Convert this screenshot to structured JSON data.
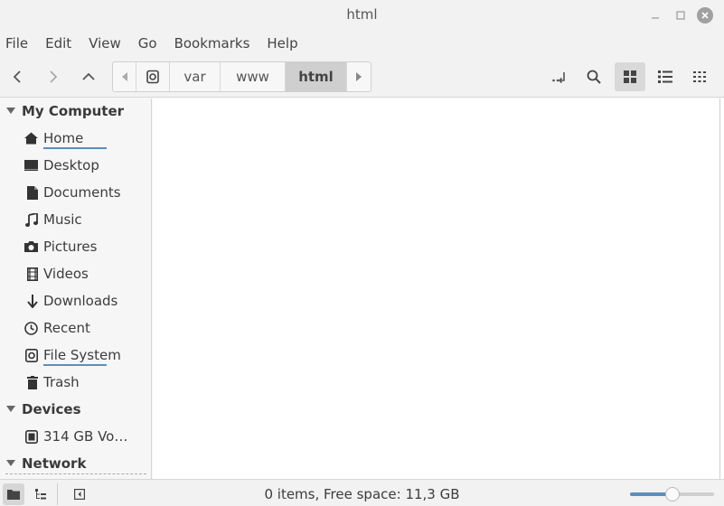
{
  "window": {
    "title": "html"
  },
  "menubar": {
    "items": [
      "File",
      "Edit",
      "View",
      "Go",
      "Bookmarks",
      "Help"
    ]
  },
  "toolbar": {
    "path": [
      "var",
      "www",
      "html"
    ]
  },
  "sidebar": {
    "sections": [
      {
        "title": "My Computer"
      },
      {
        "title": "Devices"
      },
      {
        "title": "Network"
      }
    ],
    "computer_items": [
      {
        "label": "Home",
        "icon": "home-icon"
      },
      {
        "label": "Desktop",
        "icon": "desktop-icon"
      },
      {
        "label": "Documents",
        "icon": "documents-icon"
      },
      {
        "label": "Music",
        "icon": "music-icon"
      },
      {
        "label": "Pictures",
        "icon": "pictures-icon"
      },
      {
        "label": "Videos",
        "icon": "videos-icon"
      },
      {
        "label": "Downloads",
        "icon": "downloads-icon"
      },
      {
        "label": "Recent",
        "icon": "recent-icon"
      },
      {
        "label": "File System",
        "icon": "file-system-icon"
      },
      {
        "label": "Trash",
        "icon": "trash-icon"
      }
    ],
    "device_items": [
      {
        "label": "314 GB Vo…",
        "icon": "drive-icon"
      }
    ]
  },
  "statusbar": {
    "text": "0 items, Free space: 11,3 GB",
    "zoom_level": 0.5
  },
  "colors": {
    "accent": "#5b8fbd",
    "selection": "#cfcfcf"
  }
}
